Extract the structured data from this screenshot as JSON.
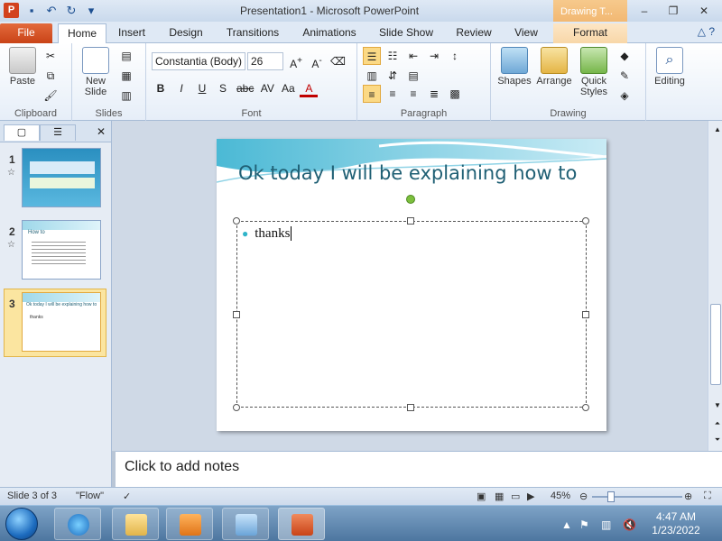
{
  "window": {
    "title": "Presentation1  -  Microsoft PowerPoint",
    "context_tab_group": "Drawing T...",
    "controls": [
      "–",
      "❐",
      "✕"
    ]
  },
  "tabs": [
    "File",
    "Home",
    "Insert",
    "Design",
    "Transitions",
    "Animations",
    "Slide Show",
    "Review",
    "View",
    "Format"
  ],
  "ribbon": {
    "clipboard": {
      "label": "Clipboard",
      "paste": "Paste"
    },
    "slides": {
      "label": "Slides",
      "new_slide_line1": "New",
      "new_slide_line2": "Slide"
    },
    "font": {
      "label": "Font",
      "font_name": "Constantia (Body)",
      "font_size": "26"
    },
    "paragraph": {
      "label": "Paragraph"
    },
    "drawing": {
      "label": "Drawing",
      "shapes": "Shapes",
      "arrange": "Arrange",
      "quick_styles_line1": "Quick",
      "quick_styles_line2": "Styles"
    },
    "editing": {
      "label": "Editing"
    }
  },
  "thumbnails": [
    {
      "number": "1",
      "has_animation": true
    },
    {
      "number": "2",
      "has_animation": true,
      "title": "How to"
    },
    {
      "number": "3",
      "has_animation": false,
      "title": "Ok today I will be explaining how to",
      "text": "thanks"
    }
  ],
  "slide": {
    "title": "Ok today I will be explaining how to",
    "bullet": "thanks"
  },
  "notes_placeholder": "Click to add notes",
  "status": {
    "slide_info": "Slide 3 of 3",
    "theme": "\"Flow\"",
    "zoom": "45%"
  },
  "clock": {
    "time": "4:47 AM",
    "date": "1/23/2022"
  },
  "colors": {
    "file_tab": "#c94317",
    "title_text": "#1f5f74",
    "accent_teal": "#2fb4c9"
  }
}
